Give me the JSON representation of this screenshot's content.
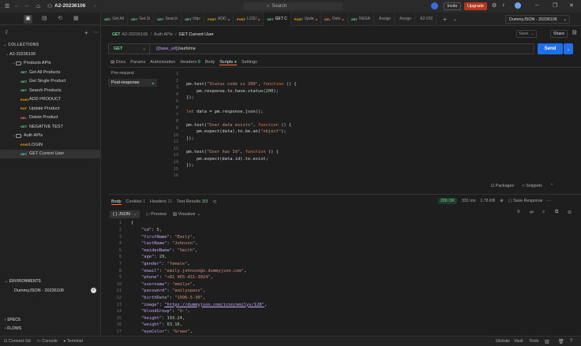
{
  "app": {
    "workspace": "A2-20236106",
    "search_placeholder": "Search",
    "invite": "Invite",
    "upgrade": "Upgrade",
    "environment": "DummyJSON - 20236106"
  },
  "tabs": [
    {
      "method": "GET",
      "label": "Get All"
    },
    {
      "method": "GET",
      "label": "Get Si"
    },
    {
      "method": "GET",
      "label": "Search"
    },
    {
      "method": "GET",
      "label": "http:"
    },
    {
      "method": "POST",
      "label": "ADD"
    },
    {
      "method": "POST",
      "label": "LOGI"
    },
    {
      "method": "GET",
      "label": "GET C"
    },
    {
      "method": "POST",
      "label": "Upda"
    },
    {
      "method": "DEL",
      "label": "Dele"
    },
    {
      "method": "GET",
      "label": "NEGA"
    },
    {
      "method": "",
      "label": "Assign"
    },
    {
      "method": "",
      "label": "Assign"
    },
    {
      "method": "",
      "label": "A2-202"
    }
  ],
  "sidebar": {
    "collections_label": "COLLECTIONS",
    "collection": "A2-20236106",
    "folder1": "Products APIs",
    "items1": [
      {
        "method": "GET",
        "label": "Get All Products"
      },
      {
        "method": "GET",
        "label": "Get Single Product"
      },
      {
        "method": "GET",
        "label": "Search Products"
      },
      {
        "method": "POST",
        "label": "ADD PRODUCT"
      },
      {
        "method": "PUT",
        "label": "Update Product"
      },
      {
        "method": "DEL",
        "label": "Delete Product"
      },
      {
        "method": "GET",
        "label": "NEGATIVE TEST"
      }
    ],
    "folder2": "Auth APIs",
    "items2": [
      {
        "method": "POST",
        "label": "LOGIN"
      },
      {
        "method": "GET",
        "label": "GET Current User"
      }
    ],
    "environments_label": "ENVIRONMENTS",
    "environment": "DummyJSON - 20236106",
    "specs": "SPECS",
    "flows": "FLOWS"
  },
  "breadcrumb": {
    "parent1": "A2-20236106",
    "parent2": "Auth APIs",
    "current": "GET Current User",
    "save": "Save",
    "share": "Share"
  },
  "request": {
    "method": "GET",
    "url_var": "{{base_url}}",
    "url_path": "/auth/me",
    "send": "Send",
    "tabs": [
      "Docs",
      "Params",
      "Authorization",
      "Headers",
      "Body",
      "Scripts",
      "Settings"
    ],
    "headers_count": "9",
    "script_tabs": [
      "Pre-request",
      "Post-response"
    ]
  },
  "script": {
    "lines": [
      "1",
      "2",
      "3",
      "4",
      "5",
      "6",
      "7",
      "8",
      "9",
      "10",
      "11",
      "12",
      "13",
      "14",
      "15",
      "16"
    ]
  },
  "script_footer": {
    "packages": "Packages",
    "snippets": "Snippets"
  },
  "response": {
    "tabs": [
      "Body",
      "Cookies",
      "Headers",
      "Test Results"
    ],
    "cookies_count": "1",
    "headers_count": "11",
    "tests": "3/3",
    "status": "200 OK",
    "time": "331 ms",
    "size": "1.76 KB",
    "save_response": "Save Response",
    "format": "JSON",
    "preview": "Preview",
    "visualize": "Visualize",
    "lines": [
      "1",
      "2",
      "3",
      "4",
      "5",
      "6",
      "7",
      "8",
      "9",
      "10",
      "11",
      "12",
      "13",
      "14",
      "15",
      "16",
      "17"
    ]
  },
  "statusbar": {
    "connect": "Connect Git",
    "console": "Console",
    "terminal": "Terminal",
    "globals": "Globals",
    "runner": "Runner",
    "start_proxy": "Start Proxy",
    "vault": "Vault",
    "tools": "Tools"
  }
}
